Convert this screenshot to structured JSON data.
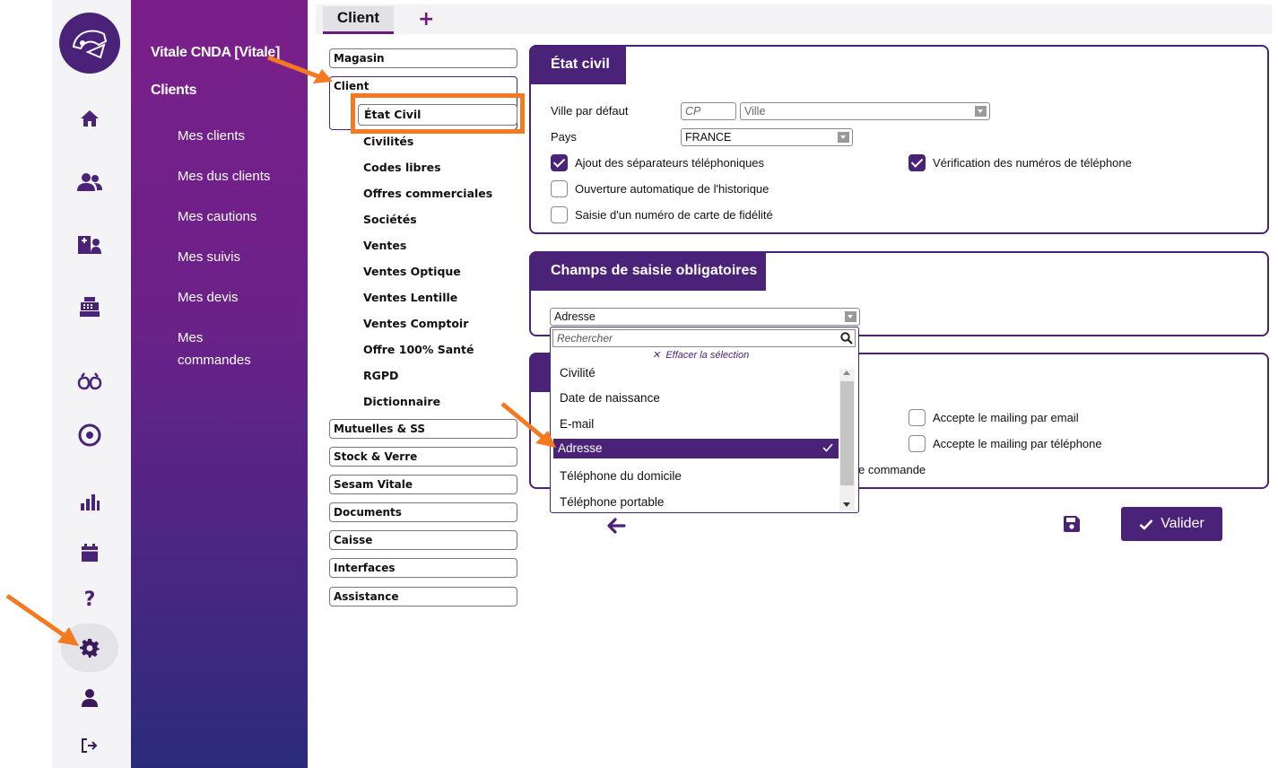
{
  "sidebar": {
    "app_title": "Vitale CNDA [Vitale]",
    "section_title": "Clients",
    "items": [
      {
        "label": "Mes clients"
      },
      {
        "label": "Mes dus clients"
      },
      {
        "label": "Mes cautions"
      },
      {
        "label": "Mes suivis"
      },
      {
        "label": "Mes devis"
      },
      {
        "label": "Mes commandes"
      }
    ]
  },
  "rail": {
    "icons": [
      "logo-icon",
      "home-icon",
      "users-icon",
      "contact-card-icon",
      "cash-register-icon",
      "glasses-icon",
      "eye-icon",
      "chart-icon",
      "calendar-icon",
      "help-icon",
      "gear-icon",
      "user-icon",
      "logout-icon"
    ],
    "help_label": "?"
  },
  "tabs": {
    "active": "Client",
    "add": "+"
  },
  "tree": {
    "magasin": "Magasin",
    "client": "Client",
    "client_children": [
      "État Civil",
      "Civilités",
      "Codes libres",
      "Offres commerciales",
      "Sociétés",
      "Ventes",
      "Ventes Optique",
      "Ventes Lentille",
      "Ventes Comptoir",
      "Offre 100% Santé",
      "RGPD",
      "Dictionnaire"
    ],
    "others": [
      "Mutuelles & SS",
      "Stock & Verre",
      "Sesam Vitale",
      "Documents",
      "Caisse",
      "Interfaces",
      "Assistance"
    ]
  },
  "etat_civil": {
    "title": "État civil",
    "ville_label": "Ville par défaut",
    "cp_placeholder": "CP",
    "ville_placeholder": "Ville",
    "pays_label": "Pays",
    "pays_value": "FRANCE",
    "checks": [
      {
        "label": "Ajout des séparateurs téléphoniques",
        "checked": true
      },
      {
        "label": "Vérification des numéros de téléphone",
        "checked": true
      },
      {
        "label": "Ouverture automatique de l'historique",
        "checked": false
      },
      {
        "label": "Saisie d'un numéro de carte de fidélité",
        "checked": false
      }
    ]
  },
  "champs": {
    "title": "Champs de saisie obligatoires",
    "selected_value": "Adresse",
    "search_placeholder": "Rechercher",
    "clear_label": "Effacer la sélection",
    "options": [
      "Civilité",
      "Date de naissance",
      "E-mail",
      "Adresse",
      "Téléphone du domicile",
      "Téléphone portable"
    ],
    "selected_option": "Adresse"
  },
  "third_card": {
    "checks": [
      {
        "label": "Accepte le mailing par email",
        "checked": false
      },
      {
        "label": "Accepte le mailing par téléphone",
        "checked": false
      }
    ],
    "partial_text": "e commande"
  },
  "actions": {
    "valider_label": "Valider"
  },
  "colors": {
    "brand_purple": "#4a2379",
    "highlight_orange": "#f47a22"
  }
}
